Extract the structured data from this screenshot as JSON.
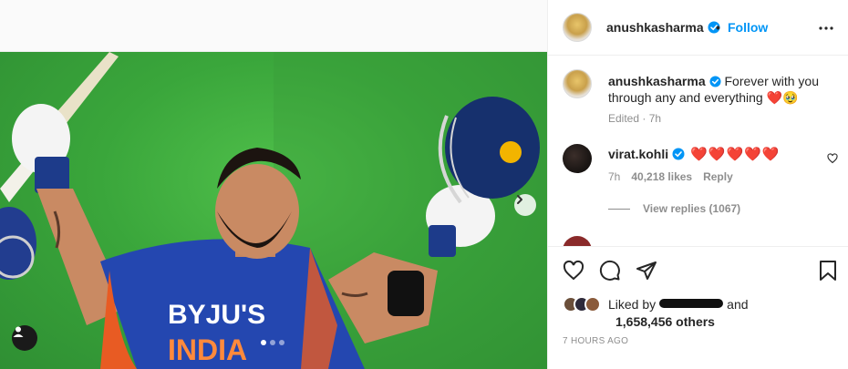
{
  "post": {
    "author": "anushkasharma",
    "follow_sep": "•",
    "follow_label": "Follow",
    "caption": "Forever with you through any and everything",
    "caption_emoji": "❤️🥹",
    "edited": "Edited",
    "caption_time": "7h",
    "carousel": {
      "slides": 3,
      "active": 0
    }
  },
  "comment": {
    "author": "virat.kohli",
    "text": "❤️❤️❤️❤️❤️",
    "time": "7h",
    "likes": "40,218 likes",
    "reply_label": "Reply",
    "view_replies": "View replies (1067)"
  },
  "likes": {
    "liked_by_prefix": "Liked by",
    "liked_by_suffix": "and",
    "others": "1,658,456 others",
    "time_ago": "7 HOURS AGO"
  },
  "icons": {
    "verified_color": "#0095f6",
    "like": "heart-icon",
    "comment": "comment-icon",
    "share": "paper-plane-icon",
    "save": "bookmark-icon"
  }
}
